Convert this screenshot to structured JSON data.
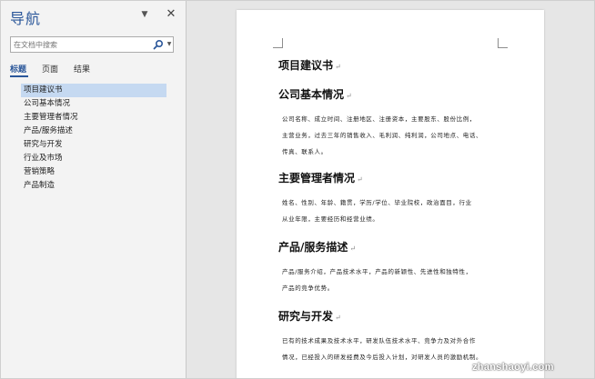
{
  "nav": {
    "title": "导航",
    "search_placeholder": "在文档中搜索",
    "tabs": [
      {
        "label": "标题",
        "active": true
      },
      {
        "label": "页面",
        "active": false
      },
      {
        "label": "结果",
        "active": false
      }
    ],
    "headings": [
      "项目建议书",
      "公司基本情况",
      "主要管理者情况",
      "产品/服务描述",
      "研究与开发",
      "行业及市场",
      "营销策略",
      "产品制造"
    ],
    "selected_heading": "项目建议书"
  },
  "document": {
    "title": "项目建议书",
    "sections": [
      {
        "heading": "公司基本情况",
        "lines": [
          "公司名称、成立时间、注册地区、注册资本，主要股东、股份比例，",
          "主营业务，过去三年的销售收入、毛利润、纯利润，公司地点、电话、",
          "传真、联系人。"
        ]
      },
      {
        "heading": "主要管理者情况",
        "lines": [
          "姓名、性别、年龄、籍贯，学历/学位、毕业院校，政治面目，行业",
          "从业年限，主要经历和经营业绩。"
        ]
      },
      {
        "heading": "产品/服务描述",
        "lines": [
          "产品/服务介绍，产品技术水平，产品的新颖性、先进性和独特性，",
          "产品的竞争优势。"
        ]
      },
      {
        "heading": "研究与开发",
        "lines": [
          "已有的技术成果及技术水平，研发队伍技术水平、竞争力及对外合作",
          "情况，已经投入的研发经费及今后投入计划，对研发人员的激励机制。"
        ]
      }
    ]
  },
  "watermark": "zhanshaoyi.com",
  "colors": {
    "accent": "#2b579a",
    "selection": "#c5d9f1"
  }
}
